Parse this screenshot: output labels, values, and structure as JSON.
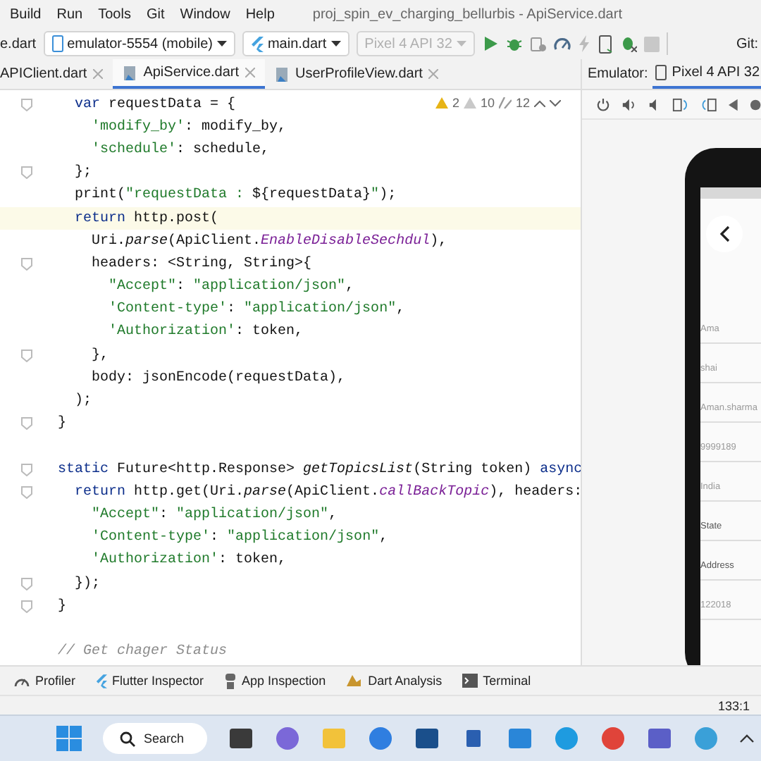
{
  "menu": [
    "Build",
    "Run",
    "Tools",
    "Git",
    "Window",
    "Help"
  ],
  "window": {
    "title": "proj_spin_ev_charging_bellurbis - ApiService.dart"
  },
  "toolbar": {
    "file_fragment": "e.dart",
    "device": "emulator-5554 (mobile)",
    "config": "main.dart",
    "avd": {
      "label": "Pixel 4 API 32",
      "disabled": true
    },
    "git_fragment": "Git:"
  },
  "tabs": [
    {
      "label": "APIClient.dart",
      "selected": false
    },
    {
      "label": "ApiService.dart",
      "selected": true
    },
    {
      "label": "UserProfileView.dart",
      "selected": false
    }
  ],
  "inspections": {
    "errors": "2",
    "warnings": "10",
    "weak": "12"
  },
  "code": [
    {
      "current": false,
      "fold": true,
      "tokens": [
        {
          "kind": "kw",
          "t": "    var"
        },
        {
          "kind": "plain",
          "t": " requestData = {"
        }
      ]
    },
    {
      "current": false,
      "fold": false,
      "tokens": [
        {
          "kind": "str",
          "t": "      'modify_by'"
        },
        {
          "kind": "plain",
          "t": ": modify_by,"
        }
      ]
    },
    {
      "current": false,
      "fold": false,
      "tokens": [
        {
          "kind": "str",
          "t": "      'schedule'"
        },
        {
          "kind": "plain",
          "t": ": schedule,"
        }
      ]
    },
    {
      "current": false,
      "fold": true,
      "tokens": [
        {
          "kind": "plain",
          "t": "    };"
        }
      ]
    },
    {
      "current": false,
      "fold": false,
      "tokens": [
        {
          "kind": "plain",
          "t": "    print("
        },
        {
          "kind": "str",
          "t": "\"requestData : "
        },
        {
          "kind": "plain",
          "t": "${requestData}"
        },
        {
          "kind": "str",
          "t": "\""
        },
        {
          "kind": "plain",
          "t": ");"
        }
      ]
    },
    {
      "current": true,
      "fold": false,
      "tokens": [
        {
          "kind": "kw",
          "t": "    return"
        },
        {
          "kind": "plain",
          "t": " http.post("
        }
      ]
    },
    {
      "current": false,
      "fold": false,
      "tokens": [
        {
          "kind": "plain",
          "t": "      Uri."
        },
        {
          "kind": "fn",
          "t": "parse"
        },
        {
          "kind": "plain",
          "t": "(ApiClient."
        },
        {
          "kind": "field",
          "t": "EnableDisableSechdul"
        },
        {
          "kind": "plain",
          "t": "),"
        }
      ]
    },
    {
      "current": false,
      "fold": true,
      "tokens": [
        {
          "kind": "plain",
          "t": "      headers: <String, String>{"
        }
      ]
    },
    {
      "current": false,
      "fold": false,
      "tokens": [
        {
          "kind": "str",
          "t": "        \"Accept\""
        },
        {
          "kind": "plain",
          "t": ": "
        },
        {
          "kind": "str",
          "t": "\"application/json\""
        },
        {
          "kind": "plain",
          "t": ","
        }
      ]
    },
    {
      "current": false,
      "fold": false,
      "tokens": [
        {
          "kind": "str",
          "t": "        'Content-type'"
        },
        {
          "kind": "plain",
          "t": ": "
        },
        {
          "kind": "str",
          "t": "\"application/json\""
        },
        {
          "kind": "plain",
          "t": ","
        }
      ]
    },
    {
      "current": false,
      "fold": false,
      "tokens": [
        {
          "kind": "str",
          "t": "        'Authorization'"
        },
        {
          "kind": "plain",
          "t": ": token,"
        }
      ]
    },
    {
      "current": false,
      "fold": true,
      "tokens": [
        {
          "kind": "plain",
          "t": "      },"
        }
      ]
    },
    {
      "current": false,
      "fold": false,
      "tokens": [
        {
          "kind": "plain",
          "t": "      body: jsonEncode(requestData),"
        }
      ]
    },
    {
      "current": false,
      "fold": false,
      "tokens": [
        {
          "kind": "plain",
          "t": "    );"
        }
      ]
    },
    {
      "current": false,
      "fold": true,
      "tokens": [
        {
          "kind": "plain",
          "t": "  }"
        }
      ]
    },
    {
      "current": false,
      "fold": false
    },
    {
      "current": false,
      "fold": true,
      "tokens": [
        {
          "kind": "kw",
          "t": "  static"
        },
        {
          "kind": "plain",
          "t": " Future<http.Response> "
        },
        {
          "kind": "fn",
          "t": "getTopicsList"
        },
        {
          "kind": "plain",
          "t": "(String token) "
        },
        {
          "kind": "kw",
          "t": "async"
        }
      ]
    },
    {
      "current": false,
      "fold": true,
      "tokens": [
        {
          "kind": "kw",
          "t": "    return"
        },
        {
          "kind": "plain",
          "t": " http.get(Uri."
        },
        {
          "kind": "fn",
          "t": "parse"
        },
        {
          "kind": "plain",
          "t": "(ApiClient."
        },
        {
          "kind": "field",
          "t": "callBackTopic"
        },
        {
          "kind": "plain",
          "t": "), headers:"
        }
      ]
    },
    {
      "current": false,
      "fold": false,
      "tokens": [
        {
          "kind": "str",
          "t": "      \"Accept\""
        },
        {
          "kind": "plain",
          "t": ": "
        },
        {
          "kind": "str",
          "t": "\"application/json\""
        },
        {
          "kind": "plain",
          "t": ","
        }
      ]
    },
    {
      "current": false,
      "fold": false,
      "tokens": [
        {
          "kind": "str",
          "t": "      'Content-type'"
        },
        {
          "kind": "plain",
          "t": ": "
        },
        {
          "kind": "str",
          "t": "\"application/json\""
        },
        {
          "kind": "plain",
          "t": ","
        }
      ]
    },
    {
      "current": false,
      "fold": false,
      "tokens": [
        {
          "kind": "str",
          "t": "      'Authorization'"
        },
        {
          "kind": "plain",
          "t": ": token,"
        }
      ]
    },
    {
      "current": false,
      "fold": true,
      "tokens": [
        {
          "kind": "plain",
          "t": "    });"
        }
      ]
    },
    {
      "current": false,
      "fold": true,
      "tokens": [
        {
          "kind": "plain",
          "t": "  }"
        }
      ]
    },
    {
      "current": false,
      "fold": false
    },
    {
      "current": false,
      "fold": false,
      "tokens": [
        {
          "kind": "cmt",
          "t": "  // Get chager Status"
        }
      ]
    }
  ],
  "emulator": {
    "label": "Emulator:",
    "tabs": [
      {
        "label": "Pixel 4 API 32",
        "selected": true
      }
    ],
    "fields": [
      {
        "text": "Ama",
        "kind": "value"
      },
      {
        "text": "shai",
        "kind": "value"
      },
      {
        "text": "Aman.sharma",
        "kind": "value"
      },
      {
        "text": "9999189",
        "kind": "value"
      },
      {
        "text": "India",
        "kind": "value"
      },
      {
        "text": "State",
        "kind": "hint"
      },
      {
        "text": "Address",
        "kind": "hint"
      },
      {
        "text": "122018",
        "kind": "value"
      }
    ]
  },
  "tool_windows": [
    "Profiler",
    "Flutter Inspector",
    "App Inspection",
    "Dart Analysis",
    "Terminal"
  ],
  "status_bar": {
    "position": "133:1"
  },
  "taskbar": {
    "search": "Search"
  }
}
